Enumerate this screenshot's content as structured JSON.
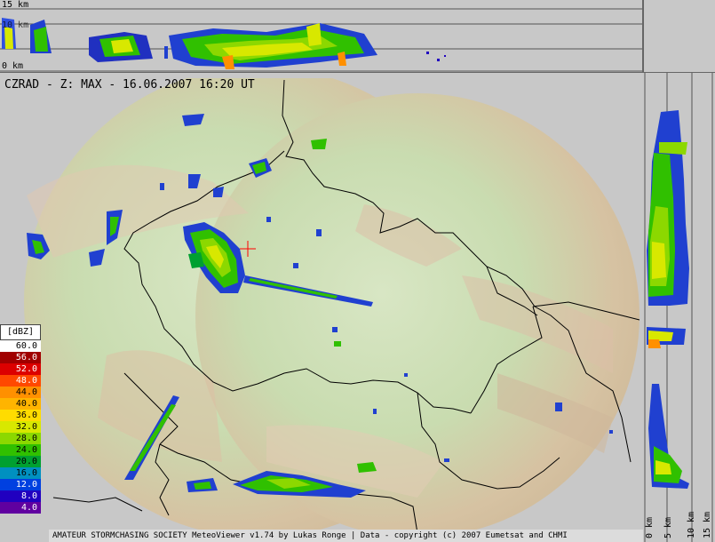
{
  "title": "CZRAD - Z: MAX - 16.06.2007   16:20 UT",
  "top_axis": {
    "top_label": "15 km",
    "mid_label": "10 km",
    "bottom_label": "0 km"
  },
  "side_axis": {
    "labels": [
      "0 km",
      "5 km",
      "10 km",
      "15 km"
    ]
  },
  "legend": {
    "unit": "[dBZ]",
    "items": [
      {
        "value": "60.0",
        "color": "#ffffff",
        "text_color": "#000000"
      },
      {
        "value": "56.0",
        "color": "#a00000",
        "text_color": "#ffffff"
      },
      {
        "value": "52.0",
        "color": "#dc0000",
        "text_color": "#ffffff"
      },
      {
        "value": "48.0",
        "color": "#ff4800",
        "text_color": "#ffffff"
      },
      {
        "value": "44.0",
        "color": "#ff9000",
        "text_color": "#000000"
      },
      {
        "value": "40.0",
        "color": "#ffb400",
        "text_color": "#000000"
      },
      {
        "value": "36.0",
        "color": "#ffdc00",
        "text_color": "#000000"
      },
      {
        "value": "32.0",
        "color": "#d8e800",
        "text_color": "#000000"
      },
      {
        "value": "28.0",
        "color": "#8cd800",
        "text_color": "#000000"
      },
      {
        "value": "24.0",
        "color": "#30c000",
        "text_color": "#000000"
      },
      {
        "value": "20.0",
        "color": "#00a030",
        "text_color": "#000000"
      },
      {
        "value": "16.0",
        "color": "#0090c0",
        "text_color": "#000000"
      },
      {
        "value": "12.0",
        "color": "#0040e0",
        "text_color": "#ffffff"
      },
      {
        "value": "8.0",
        "color": "#2000c0",
        "text_color": "#ffffff"
      },
      {
        "value": "4.0",
        "color": "#6000a0",
        "text_color": "#ffffff"
      }
    ]
  },
  "footer": "AMATEUR STORMCHASING SOCIETY MeteoViewer v1.74 by Lukas Ronge | Data - copyright (c) 2007 Eumetsat and CHMI",
  "colors": {
    "terrain_low": "#c8dcb0",
    "terrain_high": "#d8b8a0",
    "border": "#000000",
    "radar_center": "#ff0000"
  }
}
